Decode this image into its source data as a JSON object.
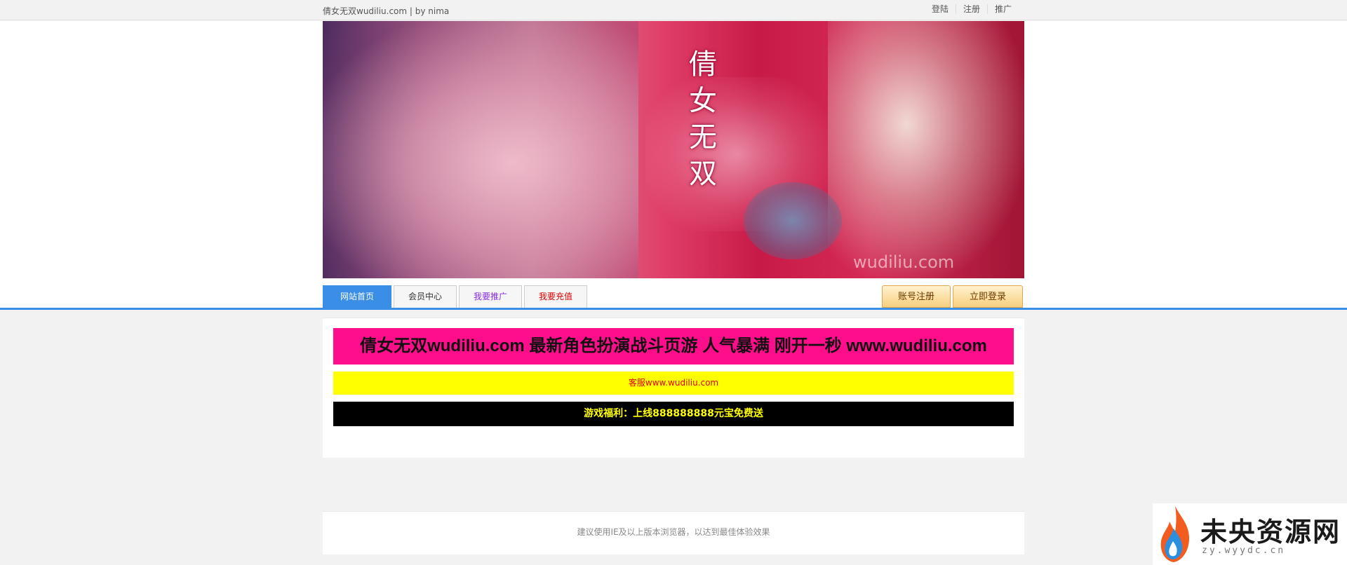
{
  "topbar": {
    "site_title": "倩女无双wudiliu.com | by nima",
    "links": [
      "登陆",
      "注册",
      "推广"
    ]
  },
  "banner": {
    "vertical_title": [
      "倩",
      "女",
      "无",
      "双"
    ],
    "watermark": "wudiliu.com"
  },
  "nav": {
    "tabs": [
      {
        "label": "网站首页",
        "color": "#ffffff",
        "active": true
      },
      {
        "label": "会员中心",
        "color": "#333333",
        "active": false
      },
      {
        "label": "我要推广",
        "color": "#8a2be2",
        "active": false
      },
      {
        "label": "我要充值",
        "color": "#e00000",
        "active": false
      }
    ],
    "register_button": "账号注册",
    "login_button": "立即登录"
  },
  "content": {
    "promo_headline": "倩女无双wudiliu.com 最新角色扮演战斗页游 人气暴满 刚开一秒 www.wudiliu.com",
    "customer_service": "客服www.wudiliu.com",
    "game_benefit": "游戏福利：上线888888888元宝免费送"
  },
  "footer": {
    "browser_notice": "建议使用IE及以上版本浏览器，以达到最佳体验效果"
  },
  "corner_logo": {
    "text": "未央资源网",
    "subtext": "zy.wyydc.cn"
  },
  "colors": {
    "accent_blue": "#3a8ee6",
    "promo_magenta": "#ff0e8c",
    "promo_yellow": "#ffff00",
    "promo_black": "#000000",
    "button_orange": "#f8cf7f"
  }
}
